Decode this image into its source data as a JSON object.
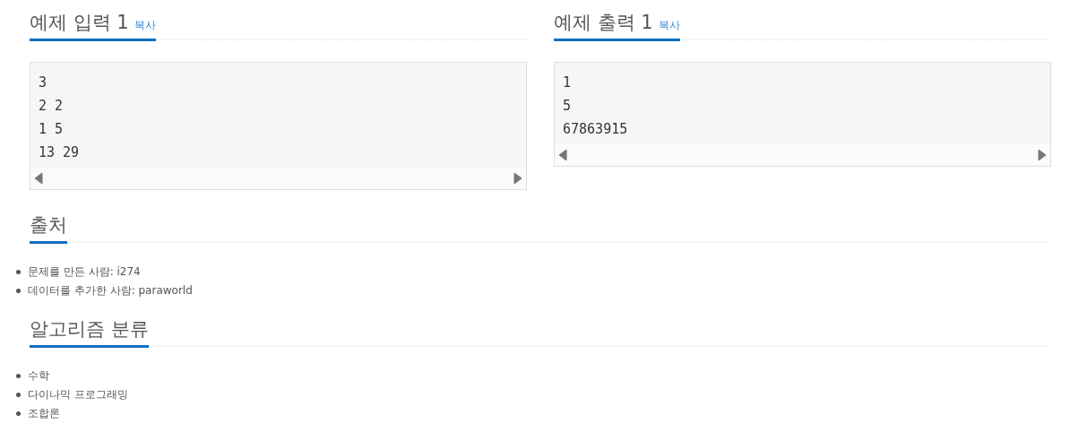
{
  "samples": [
    {
      "title": "예제 입력 1",
      "copy_label": "복사",
      "lines": [
        "3",
        "2 2",
        "1 5",
        "13 29"
      ]
    },
    {
      "title": "예제 출력 1",
      "copy_label": "복사",
      "lines": [
        "1",
        "5",
        "67863915"
      ]
    }
  ],
  "sections": [
    {
      "title": "출처",
      "items": [
        "문제를 만든 사람: i274",
        "데이터를 추가한 사람: paraworld"
      ]
    },
    {
      "title": "알고리즘 분류",
      "items": [
        "수학",
        "다이나믹 프로그래밍",
        "조합론"
      ]
    }
  ]
}
